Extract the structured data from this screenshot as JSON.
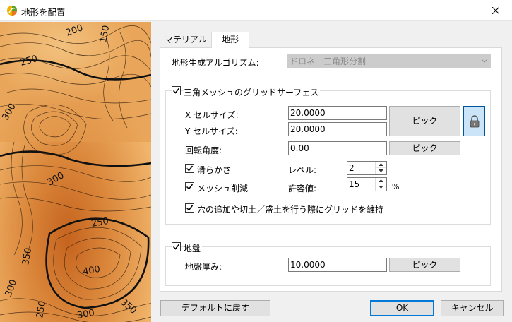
{
  "window": {
    "title": "地形を配置"
  },
  "map_labels": [
    "200",
    "150",
    "250",
    "300",
    "300",
    "250",
    "400",
    "350",
    "350",
    "300",
    "250",
    "300"
  ],
  "tabs": [
    {
      "label": "マテリアル"
    },
    {
      "label": "地形"
    }
  ],
  "terrain": {
    "algorithm_label": "地形生成アルゴリズム:",
    "algorithm_value": "ドロネー三角形分割",
    "triangle_mesh": {
      "label": "三角メッシュのグリッドサーフェス",
      "checked": true,
      "x_cell_label": "X セルサイズ:",
      "x_cell_value": "20.0000",
      "y_cell_label": "Y セルサイズ:",
      "y_cell_value": "20.0000",
      "pick_label": "ピック",
      "rotation_label": "回転角度:",
      "rotation_value": "0.00",
      "rotation_pick_label": "ピック",
      "smooth_label": "滑らかさ",
      "smooth_checked": true,
      "level_label": "レベル:",
      "level_value": "2",
      "reduce_label": "メッシュ削減",
      "reduce_checked": true,
      "tolerance_label": "許容値:",
      "tolerance_value": "15",
      "tolerance_unit": "%",
      "keep_grid_label": "穴の追加や切土／盛土を行う際にグリッドを維持",
      "keep_grid_checked": true
    },
    "base": {
      "label": "地盤",
      "checked": true,
      "thickness_label": "地盤厚み:",
      "thickness_value": "10.0000",
      "pick_label": "ピック"
    }
  },
  "footer": {
    "reset_label": "デフォルトに戻す",
    "ok_label": "OK",
    "cancel_label": "キャンセル"
  },
  "colors": {
    "accent": "#0078d7",
    "map_base": "#e9a45a",
    "disabled_combo": "#cccccc"
  }
}
